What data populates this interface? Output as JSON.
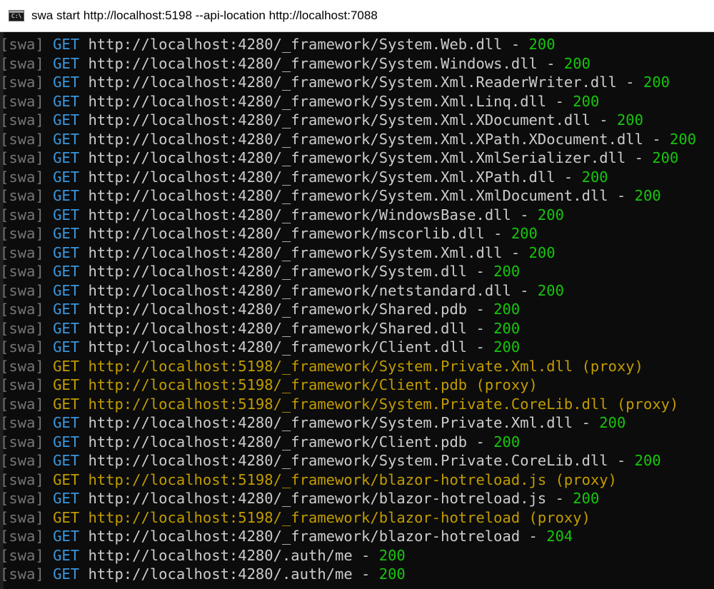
{
  "window": {
    "icon_name": "console-app-icon",
    "icon_text": "C:\\",
    "title": "swa start http://localhost:5198 --api-location http://localhost:7088"
  },
  "colors": {
    "background": "#0c0c0c",
    "tag": "#767676",
    "get_blue": "#3a96dd",
    "text_white": "#cccccc",
    "status_green": "#16c60c",
    "proxy_yellow": "#c19c00"
  },
  "log": [
    {
      "tag": "[swa]",
      "method": "GET",
      "url": "http://localhost:4280/_framework/System.Web.dll",
      "sep": " - ",
      "status": "200",
      "proxy": false
    },
    {
      "tag": "[swa]",
      "method": "GET",
      "url": "http://localhost:4280/_framework/System.Windows.dll",
      "sep": " - ",
      "status": "200",
      "proxy": false
    },
    {
      "tag": "[swa]",
      "method": "GET",
      "url": "http://localhost:4280/_framework/System.Xml.ReaderWriter.dll",
      "sep": " - ",
      "status": "200",
      "proxy": false
    },
    {
      "tag": "[swa]",
      "method": "GET",
      "url": "http://localhost:4280/_framework/System.Xml.Linq.dll",
      "sep": " - ",
      "status": "200",
      "proxy": false
    },
    {
      "tag": "[swa]",
      "method": "GET",
      "url": "http://localhost:4280/_framework/System.Xml.XDocument.dll",
      "sep": " - ",
      "status": "200",
      "proxy": false
    },
    {
      "tag": "[swa]",
      "method": "GET",
      "url": "http://localhost:4280/_framework/System.Xml.XPath.XDocument.dll",
      "sep": " - ",
      "status": "200",
      "proxy": false
    },
    {
      "tag": "[swa]",
      "method": "GET",
      "url": "http://localhost:4280/_framework/System.Xml.XmlSerializer.dll",
      "sep": " - ",
      "status": "200",
      "proxy": false
    },
    {
      "tag": "[swa]",
      "method": "GET",
      "url": "http://localhost:4280/_framework/System.Xml.XPath.dll",
      "sep": " - ",
      "status": "200",
      "proxy": false
    },
    {
      "tag": "[swa]",
      "method": "GET",
      "url": "http://localhost:4280/_framework/System.Xml.XmlDocument.dll",
      "sep": " - ",
      "status": "200",
      "proxy": false
    },
    {
      "tag": "[swa]",
      "method": "GET",
      "url": "http://localhost:4280/_framework/WindowsBase.dll",
      "sep": " - ",
      "status": "200",
      "proxy": false
    },
    {
      "tag": "[swa]",
      "method": "GET",
      "url": "http://localhost:4280/_framework/mscorlib.dll",
      "sep": " - ",
      "status": "200",
      "proxy": false
    },
    {
      "tag": "[swa]",
      "method": "GET",
      "url": "http://localhost:4280/_framework/System.Xml.dll",
      "sep": " - ",
      "status": "200",
      "proxy": false
    },
    {
      "tag": "[swa]",
      "method": "GET",
      "url": "http://localhost:4280/_framework/System.dll",
      "sep": " - ",
      "status": "200",
      "proxy": false
    },
    {
      "tag": "[swa]",
      "method": "GET",
      "url": "http://localhost:4280/_framework/netstandard.dll",
      "sep": " - ",
      "status": "200",
      "proxy": false
    },
    {
      "tag": "[swa]",
      "method": "GET",
      "url": "http://localhost:4280/_framework/Shared.pdb",
      "sep": " - ",
      "status": "200",
      "proxy": false
    },
    {
      "tag": "[swa]",
      "method": "GET",
      "url": "http://localhost:4280/_framework/Shared.dll",
      "sep": " - ",
      "status": "200",
      "proxy": false
    },
    {
      "tag": "[swa]",
      "method": "GET",
      "url": "http://localhost:4280/_framework/Client.dll",
      "sep": " - ",
      "status": "200",
      "proxy": false
    },
    {
      "tag": "[swa]",
      "method": "GET",
      "url": "http://localhost:5198/_framework/System.Private.Xml.dll",
      "sep": " ",
      "status": "(proxy)",
      "proxy": true
    },
    {
      "tag": "[swa]",
      "method": "GET",
      "url": "http://localhost:5198/_framework/Client.pdb",
      "sep": " ",
      "status": "(proxy)",
      "proxy": true
    },
    {
      "tag": "[swa]",
      "method": "GET",
      "url": "http://localhost:5198/_framework/System.Private.CoreLib.dll",
      "sep": " ",
      "status": "(proxy)",
      "proxy": true
    },
    {
      "tag": "[swa]",
      "method": "GET",
      "url": "http://localhost:4280/_framework/System.Private.Xml.dll",
      "sep": " - ",
      "status": "200",
      "proxy": false
    },
    {
      "tag": "[swa]",
      "method": "GET",
      "url": "http://localhost:4280/_framework/Client.pdb",
      "sep": " - ",
      "status": "200",
      "proxy": false
    },
    {
      "tag": "[swa]",
      "method": "GET",
      "url": "http://localhost:4280/_framework/System.Private.CoreLib.dll",
      "sep": " - ",
      "status": "200",
      "proxy": false
    },
    {
      "tag": "[swa]",
      "method": "GET",
      "url": "http://localhost:5198/_framework/blazor-hotreload.js",
      "sep": " ",
      "status": "(proxy)",
      "proxy": true
    },
    {
      "tag": "[swa]",
      "method": "GET",
      "url": "http://localhost:4280/_framework/blazor-hotreload.js",
      "sep": " - ",
      "status": "200",
      "proxy": false
    },
    {
      "tag": "[swa]",
      "method": "GET",
      "url": "http://localhost:5198/_framework/blazor-hotreload",
      "sep": " ",
      "status": "(proxy)",
      "proxy": true
    },
    {
      "tag": "[swa]",
      "method": "GET",
      "url": "http://localhost:4280/_framework/blazor-hotreload",
      "sep": " - ",
      "status": "204",
      "proxy": false
    },
    {
      "tag": "[swa]",
      "method": "GET",
      "url": "http://localhost:4280/.auth/me",
      "sep": " - ",
      "status": "200",
      "proxy": false
    },
    {
      "tag": "[swa]",
      "method": "GET",
      "url": "http://localhost:4280/.auth/me",
      "sep": " - ",
      "status": "200",
      "proxy": false
    }
  ]
}
